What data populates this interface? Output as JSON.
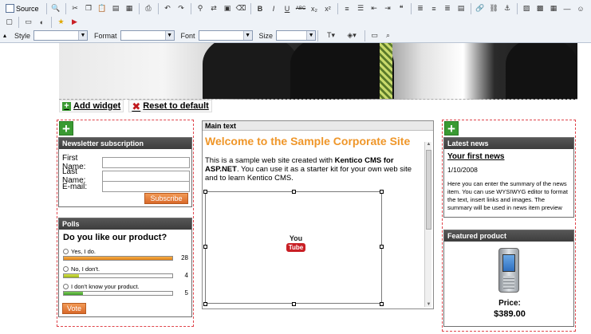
{
  "toolbar": {
    "source_label": "Source",
    "style_label": "Style",
    "format_label": "Format",
    "font_label": "Font",
    "size_label": "Size",
    "bold_glyph": "B",
    "italic_glyph": "I",
    "underline_glyph": "U",
    "strike_glyph": "ABC",
    "subscript_glyph": "x₂",
    "superscript_glyph": "x²"
  },
  "widget_actions": {
    "add_widget": "Add widget",
    "reset_default": "Reset to default"
  },
  "newsletter": {
    "title": "Newsletter subscription",
    "first_name": "First Name:",
    "last_name": "Last Name:",
    "email": "E-mail:",
    "subscribe": "Subscribe"
  },
  "polls": {
    "title": "Polls",
    "question": "Do you like our product?",
    "options": [
      {
        "label": "Yes, I do.",
        "count": "28",
        "fraction": 1.0
      },
      {
        "label": "No, I don't.",
        "count": "4",
        "fraction": 0.14
      },
      {
        "label": "I don't know your product.",
        "count": "5",
        "fraction": 0.18
      }
    ],
    "vote": "Vote"
  },
  "main_text": {
    "header": "Main text",
    "title": "Welcome to the Sample Corporate Site",
    "para_pre": "This is a sample web site created with ",
    "para_bold": "Kentico CMS for ASP.NET",
    "para_post": ". You can use it as a starter kit for your own web site and to learn Kentico CMS.",
    "video_you": "You",
    "video_tube": "Tube"
  },
  "latest_news": {
    "title": "Latest news",
    "item_title": "Your first news",
    "item_date": "1/10/2008",
    "item_summary": "Here you can enter the summary of the news item. You can use WYSIWYG editor to format the text, insert links and images. The summary will be used in news item preview"
  },
  "featured": {
    "title": "Featured product",
    "price_label": "Price:",
    "price_value": "$389.00"
  },
  "colors": {
    "accent_orange": "#ef9629",
    "zone_border": "#e0444b",
    "add_green": "#3a9a32",
    "header_dark": "#4a4a4a"
  }
}
